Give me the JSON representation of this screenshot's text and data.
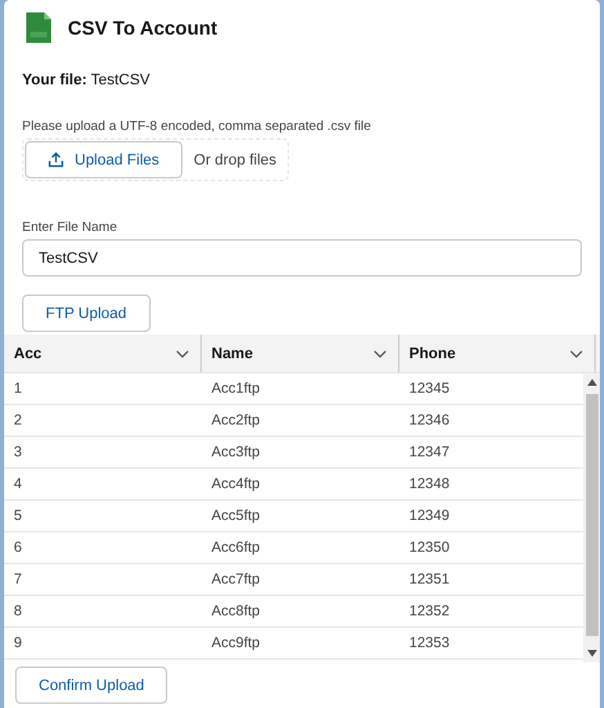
{
  "header": {
    "title": "CSV To Account"
  },
  "file": {
    "label": "Your file:",
    "value": "TestCSV"
  },
  "upload": {
    "hint": "Please upload a UTF-8 encoded, comma separated .csv file",
    "button": "Upload Files",
    "drop_text": "Or drop files"
  },
  "file_name": {
    "label": "Enter File Name",
    "value": "TestCSV"
  },
  "ftp_button": "FTP Upload",
  "table": {
    "columns": [
      "Acc",
      "Name",
      "Phone"
    ],
    "rows": [
      [
        "1",
        "Acc1ftp",
        "12345"
      ],
      [
        "2",
        "Acc2ftp",
        "12346"
      ],
      [
        "3",
        "Acc3ftp",
        "12347"
      ],
      [
        "4",
        "Acc4ftp",
        "12348"
      ],
      [
        "5",
        "Acc5ftp",
        "12349"
      ],
      [
        "6",
        "Acc6ftp",
        "12350"
      ],
      [
        "7",
        "Acc7ftp",
        "12351"
      ],
      [
        "8",
        "Acc8ftp",
        "12352"
      ],
      [
        "9",
        "Acc9ftp",
        "12353"
      ]
    ]
  },
  "confirm_button": "Confirm Upload"
}
